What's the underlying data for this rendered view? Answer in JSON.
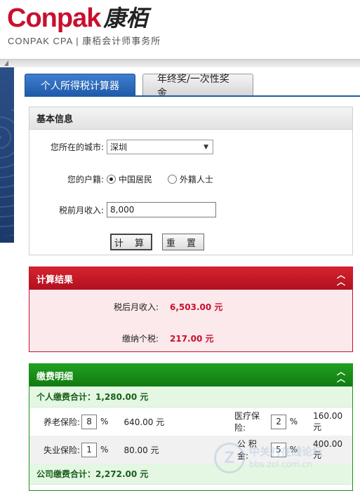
{
  "brand": {
    "logo_word": "Conpak",
    "logo_cn": "康栢",
    "subtitle": "CONPAK CPA | 康栢会计师事务所"
  },
  "tabs": [
    {
      "label": "个人所得税计算器",
      "active": true
    },
    {
      "label": "年终奖/一次性奖金",
      "active": false
    }
  ],
  "basic": {
    "title": "基本信息",
    "city_label": "您所在的城市:",
    "city_value": "深圳",
    "residence_label": "您的户籍:",
    "residence_options": [
      "中国居民",
      "外籍人士"
    ],
    "residence_selected": "中国居民",
    "income_label": "税前月收入:",
    "income_value": "8,000",
    "calc_button": "计 算",
    "reset_button": "重 置"
  },
  "result": {
    "title": "计算结果",
    "after_tax_label": "税后月收入:",
    "after_tax_value": "6,503.00 元",
    "tax_label": "缴纳个税:",
    "tax_value": "217.00 元"
  },
  "fee": {
    "title": "缴费明细",
    "personal_total": "个人缴费合计：1,280.00 元",
    "items": [
      {
        "label": "养老保险:",
        "pct": "8",
        "unit": "%",
        "amount": "640.00 元"
      },
      {
        "label": "医疗保险:",
        "pct": "2",
        "unit": "%",
        "amount": "160.00 元"
      },
      {
        "label": "失业保险:",
        "pct": "1",
        "unit": "%",
        "amount": "80.00 元"
      },
      {
        "label": "公 积 金:",
        "pct": "5",
        "unit": "%",
        "amount": "400.00 元"
      }
    ],
    "company_total": "公司缴费合计：2,272.00 元"
  },
  "watermark": {
    "letter": "Z",
    "line1": "中关村在线论坛",
    "line2": "bbs.zol.com.cn"
  },
  "colors": {
    "brand_red": "#c8102e",
    "tab_blue": "#1f5aa8",
    "result_red": "#b01020",
    "fee_green": "#117a11"
  }
}
